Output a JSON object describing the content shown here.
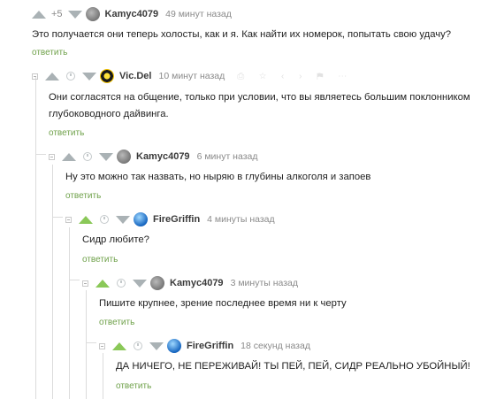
{
  "comments": [
    {
      "rating": "+5",
      "user": "Kamyc4079",
      "time": "49 минут назад",
      "text": "Это получается они теперь холосты, как и я. Как найти их номерок, попытать свою удачу?",
      "reply": "ответить"
    },
    {
      "user": "Vic.Del",
      "time": "10 минут назад",
      "tools": "⎙ ☆ ‹ ›  ⚑ ⋯",
      "text_lines": [
        "Они согласятся на общение, только при условии, что вы являетесь большим поклонником",
        "глубоководного дайвинга."
      ],
      "reply": "ответить"
    },
    {
      "user": "Kamyc4079",
      "time": "6 минут назад",
      "text": "Ну это можно так назвать, но ныряю в глубины алкоголя и запоев",
      "reply": "ответить"
    },
    {
      "user": "FireGriffin",
      "time": "4 минуты назад",
      "text": "Сидр любите?",
      "reply": "ответить"
    },
    {
      "user": "Kamyc4079",
      "time": "3 минуты назад",
      "text": "Пишите крупнее, зрение последнее время ни к черту",
      "reply": "ответить"
    },
    {
      "user": "FireGriffin",
      "time": "18 секунд назад",
      "text": "ДА НИЧЕГО, НЕ ПЕРЕЖИВАЙ! ТЫ ПЕЙ, ПЕЙ, СИДР РЕАЛЬНО УБОЙНЫЙ!",
      "reply": "ответить"
    }
  ],
  "colors": {
    "upvote_active": "#8ac858",
    "reply_link": "#6fa14a",
    "vote_inactive": "#aab2b5"
  }
}
